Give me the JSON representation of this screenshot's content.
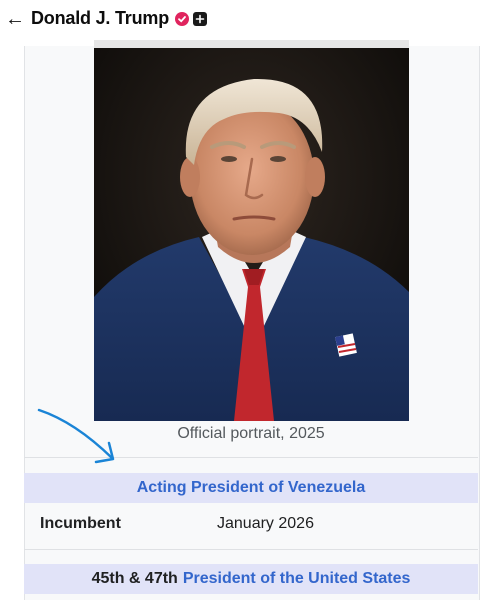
{
  "header": {
    "back_icon": "arrow-left-icon",
    "title": "Donald J. Trump",
    "verified_color": "#e0245e"
  },
  "infobox": {
    "caption": "Official portrait, 2025",
    "office1": {
      "title": "Acting President of Venezuela",
      "row_label": "Incumbent",
      "row_value": "January 2026"
    },
    "office2": {
      "ordinal": "45th & 47th",
      "title": "President of the United States"
    }
  },
  "annotation": {
    "arrow_icon": "hand-drawn-arrow-icon",
    "arrow_color": "#1a84d6"
  },
  "colors": {
    "link": "#3366cc",
    "office_header_bg": "#e1e3f8"
  }
}
